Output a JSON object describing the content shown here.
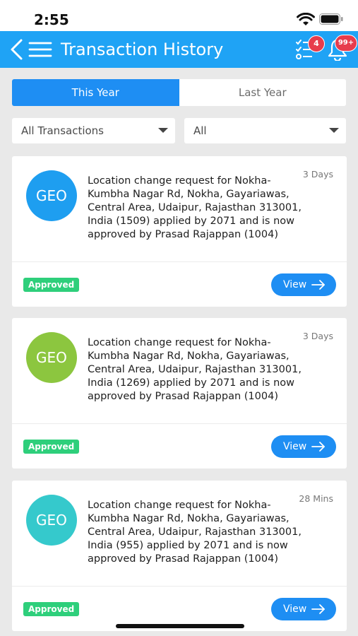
{
  "status_bar": {
    "time": "2:55"
  },
  "header": {
    "title": "Transaction History",
    "tasks_badge": "4",
    "notifications_badge": "99+"
  },
  "tabs": [
    {
      "label": "This Year",
      "active": true
    },
    {
      "label": "Last Year",
      "active": false
    }
  ],
  "filters": {
    "type": "All Transactions",
    "status": "All"
  },
  "colors": {
    "header": "#1fa3f5",
    "accent": "#1e8ef3",
    "approved": "#2ecf7b",
    "avatar_blue": "#1e9ef0",
    "avatar_green": "#8cc63f",
    "avatar_teal": "#35c9cc"
  },
  "cards": [
    {
      "avatar": "GEO",
      "avatar_color": "#1e9ef0",
      "text": "Location change request for Nokha-Kumbha Nagar Rd, Nokha, Gayariawas, Central Area, Udaipur, Rajasthan 313001, India (1509) applied by 2071 and is now approved by Prasad Rajappan (1004)",
      "time": "3 Days",
      "status": "Approved",
      "action": "View"
    },
    {
      "avatar": "GEO",
      "avatar_color": "#8cc63f",
      "text": "Location change request for Nokha-Kumbha Nagar Rd, Nokha, Gayariawas, Central Area, Udaipur, Rajasthan 313001, India (1269) applied by 2071 and is now approved by Prasad Rajappan (1004)",
      "time": "3 Days",
      "status": "Approved",
      "action": "View"
    },
    {
      "avatar": "GEO",
      "avatar_color": "#35c9cc",
      "text": "Location change request for Nokha-Kumbha Nagar Rd, Nokha, Gayariawas, Central Area, Udaipur, Rajasthan 313001, India (955) applied by 2071 and is now approved by Prasad Rajappan (1004)",
      "time": "28 Mins",
      "status": "Approved",
      "action": "View"
    }
  ]
}
